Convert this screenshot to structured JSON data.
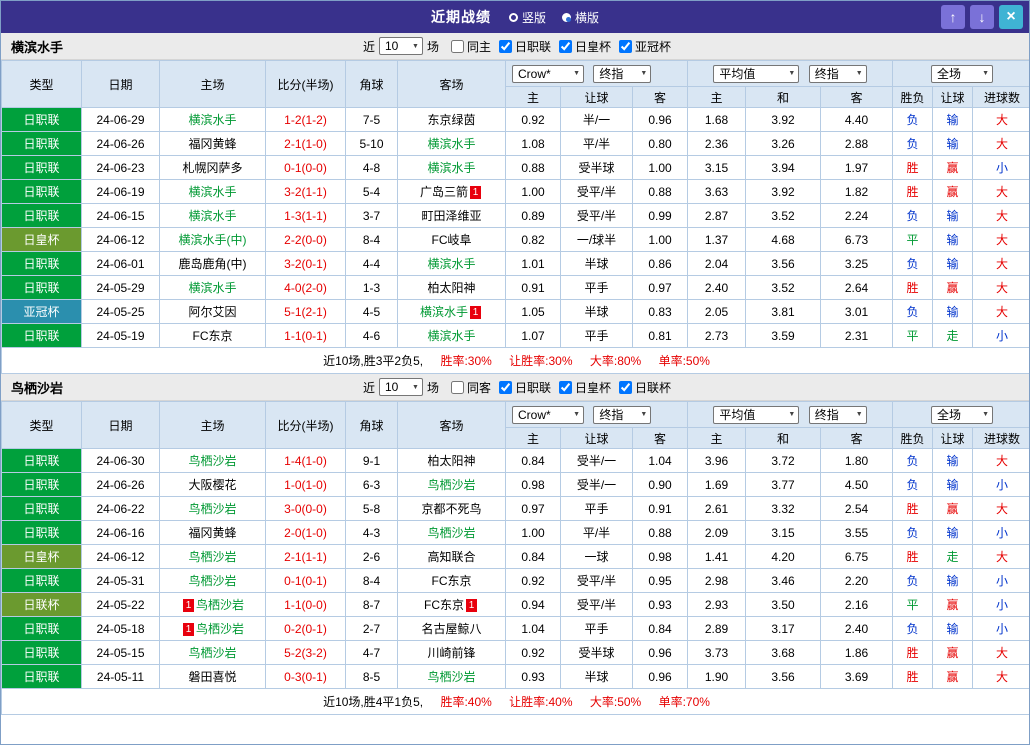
{
  "titlebar": {
    "title": "近期战绩",
    "views": [
      {
        "label": "竖版",
        "selected": false
      },
      {
        "label": "横版",
        "selected": true
      }
    ],
    "buttons": {
      "up": "↑",
      "down": "↓",
      "close": "×"
    }
  },
  "type_colors": {
    "日职联": "#00a03c",
    "日皇杯": "#6b9a2f",
    "亚冠杯": "#2b8fae",
    "日联杯": "#6b9a2f"
  },
  "result_colors": {
    "red": "#e60000",
    "blue": "#0033cc",
    "green": "#009933"
  },
  "sections": [
    {
      "team": "横滨水手",
      "filters": {
        "near": "近",
        "count": "10",
        "unit": "场",
        "checkboxes": [
          {
            "label": "同主",
            "checked": false
          },
          {
            "label": "日职联",
            "checked": true
          },
          {
            "label": "日皇杯",
            "checked": true
          },
          {
            "label": "亚冠杯",
            "checked": true
          }
        ]
      },
      "columns": {
        "type": "类型",
        "date": "日期",
        "home": "主场",
        "score": "比分(半场)",
        "corner": "角球",
        "away": "客场",
        "odds_source": "Crow*",
        "odds_final": "终指",
        "avg": "平均值",
        "avg_final": "终指",
        "scope": "全场",
        "sub": [
          "主",
          "让球",
          "客",
          "主",
          "和",
          "客",
          "胜负",
          "让球",
          "进球数"
        ]
      },
      "rows": [
        {
          "type": "日职联",
          "date": "24-06-29",
          "home": {
            "name": "横滨水手",
            "focus": true
          },
          "score": "1-2(1-2)",
          "corner": "7-5",
          "away": {
            "name": "东京绿茵"
          },
          "odds": [
            "0.92",
            "半/一",
            "0.96"
          ],
          "avg": [
            "1.68",
            "3.92",
            "4.40"
          ],
          "result": "负",
          "handicap_result": "输",
          "goals": "大"
        },
        {
          "type": "日职联",
          "date": "24-06-26",
          "home": {
            "name": "福冈黄蜂"
          },
          "score": "2-1(1-0)",
          "corner": "5-10",
          "away": {
            "name": "横滨水手",
            "focus": true
          },
          "odds": [
            "1.08",
            "平/半",
            "0.80"
          ],
          "avg": [
            "2.36",
            "3.26",
            "2.88"
          ],
          "result": "负",
          "handicap_result": "输",
          "goals": "大"
        },
        {
          "type": "日职联",
          "date": "24-06-23",
          "home": {
            "name": "札幌冈萨多"
          },
          "score": "0-1(0-0)",
          "corner": "4-8",
          "away": {
            "name": "横滨水手",
            "focus": true
          },
          "odds": [
            "0.88",
            "受半球",
            "1.00"
          ],
          "avg": [
            "3.15",
            "3.94",
            "1.97"
          ],
          "result": "胜",
          "handicap_result": "赢",
          "goals": "小"
        },
        {
          "type": "日职联",
          "date": "24-06-19",
          "home": {
            "name": "横滨水手",
            "focus": true
          },
          "score": "3-2(1-1)",
          "corner": "5-4",
          "away": {
            "name": "广岛三箭",
            "card": "1"
          },
          "odds": [
            "1.00",
            "受平/半",
            "0.88"
          ],
          "avg": [
            "3.63",
            "3.92",
            "1.82"
          ],
          "result": "胜",
          "handicap_result": "赢",
          "goals": "大"
        },
        {
          "type": "日职联",
          "date": "24-06-15",
          "home": {
            "name": "横滨水手",
            "focus": true
          },
          "score": "1-3(1-1)",
          "corner": "3-7",
          "away": {
            "name": "町田泽维亚"
          },
          "odds": [
            "0.89",
            "受平/半",
            "0.99"
          ],
          "avg": [
            "2.87",
            "3.52",
            "2.24"
          ],
          "result": "负",
          "handicap_result": "输",
          "goals": "大"
        },
        {
          "type": "日皇杯",
          "date": "24-06-12",
          "home": {
            "name": "横滨水手(中)",
            "focus": true
          },
          "score": "2-2(0-0)",
          "corner": "8-4",
          "away": {
            "name": "FC岐阜"
          },
          "odds": [
            "0.82",
            "一/球半",
            "1.00"
          ],
          "avg": [
            "1.37",
            "4.68",
            "6.73"
          ],
          "result": "平",
          "handicap_result": "输",
          "goals": "大"
        },
        {
          "type": "日职联",
          "date": "24-06-01",
          "home": {
            "name": "鹿岛鹿角(中)"
          },
          "score": "3-2(0-1)",
          "corner": "4-4",
          "away": {
            "name": "横滨水手",
            "focus": true
          },
          "odds": [
            "1.01",
            "半球",
            "0.86"
          ],
          "avg": [
            "2.04",
            "3.56",
            "3.25"
          ],
          "result": "负",
          "handicap_result": "输",
          "goals": "大"
        },
        {
          "type": "日职联",
          "date": "24-05-29",
          "home": {
            "name": "横滨水手",
            "focus": true
          },
          "score": "4-0(2-0)",
          "corner": "1-3",
          "away": {
            "name": "柏太阳神"
          },
          "odds": [
            "0.91",
            "平手",
            "0.97"
          ],
          "avg": [
            "2.40",
            "3.52",
            "2.64"
          ],
          "result": "胜",
          "handicap_result": "赢",
          "goals": "大"
        },
        {
          "type": "亚冠杯",
          "date": "24-05-25",
          "home": {
            "name": "阿尔艾因"
          },
          "score": "5-1(2-1)",
          "corner": "4-5",
          "away": {
            "name": "横滨水手",
            "focus": true,
            "card": "1"
          },
          "odds": [
            "1.05",
            "半球",
            "0.83"
          ],
          "avg": [
            "2.05",
            "3.81",
            "3.01"
          ],
          "result": "负",
          "handicap_result": "输",
          "goals": "大"
        },
        {
          "type": "日职联",
          "date": "24-05-19",
          "home": {
            "name": "FC东京"
          },
          "score": "1-1(0-1)",
          "corner": "4-6",
          "away": {
            "name": "横滨水手",
            "focus": true
          },
          "odds": [
            "1.07",
            "平手",
            "0.81"
          ],
          "avg": [
            "2.73",
            "3.59",
            "2.31"
          ],
          "result": "平",
          "handicap_result": "走",
          "goals": "小"
        }
      ],
      "summary": {
        "record": "近10场,胜3平2负5,",
        "stats": [
          "胜率:30%",
          "让胜率:30%",
          "大率:80%",
          "单率:50%"
        ]
      }
    },
    {
      "team": "鸟栖沙岩",
      "filters": {
        "near": "近",
        "count": "10",
        "unit": "场",
        "checkboxes": [
          {
            "label": "同客",
            "checked": false
          },
          {
            "label": "日职联",
            "checked": true
          },
          {
            "label": "日皇杯",
            "checked": true
          },
          {
            "label": "日联杯",
            "checked": true
          }
        ]
      },
      "columns": {
        "type": "类型",
        "date": "日期",
        "home": "主场",
        "score": "比分(半场)",
        "corner": "角球",
        "away": "客场",
        "odds_source": "Crow*",
        "odds_final": "终指",
        "avg": "平均值",
        "avg_final": "终指",
        "scope": "全场",
        "sub": [
          "主",
          "让球",
          "客",
          "主",
          "和",
          "客",
          "胜负",
          "让球",
          "进球数"
        ]
      },
      "rows": [
        {
          "type": "日职联",
          "date": "24-06-30",
          "home": {
            "name": "鸟栖沙岩",
            "focus": true
          },
          "score": "1-4(1-0)",
          "corner": "9-1",
          "away": {
            "name": "柏太阳神"
          },
          "odds": [
            "0.84",
            "受半/一",
            "1.04"
          ],
          "avg": [
            "3.96",
            "3.72",
            "1.80"
          ],
          "result": "负",
          "handicap_result": "输",
          "goals": "大"
        },
        {
          "type": "日职联",
          "date": "24-06-26",
          "home": {
            "name": "大阪樱花"
          },
          "score": "1-0(1-0)",
          "corner": "6-3",
          "away": {
            "name": "鸟栖沙岩",
            "focus": true
          },
          "odds": [
            "0.98",
            "受半/一",
            "0.90"
          ],
          "avg": [
            "1.69",
            "3.77",
            "4.50"
          ],
          "result": "负",
          "handicap_result": "输",
          "goals": "小"
        },
        {
          "type": "日职联",
          "date": "24-06-22",
          "home": {
            "name": "鸟栖沙岩",
            "focus": true
          },
          "score": "3-0(0-0)",
          "corner": "5-8",
          "away": {
            "name": "京都不死鸟"
          },
          "odds": [
            "0.97",
            "平手",
            "0.91"
          ],
          "avg": [
            "2.61",
            "3.32",
            "2.54"
          ],
          "result": "胜",
          "handicap_result": "赢",
          "goals": "大"
        },
        {
          "type": "日职联",
          "date": "24-06-16",
          "home": {
            "name": "福冈黄蜂"
          },
          "score": "2-0(1-0)",
          "corner": "4-3",
          "away": {
            "name": "鸟栖沙岩",
            "focus": true
          },
          "odds": [
            "1.00",
            "平/半",
            "0.88"
          ],
          "avg": [
            "2.09",
            "3.15",
            "3.55"
          ],
          "result": "负",
          "handicap_result": "输",
          "goals": "小"
        },
        {
          "type": "日皇杯",
          "date": "24-06-12",
          "home": {
            "name": "鸟栖沙岩",
            "focus": true
          },
          "score": "2-1(1-1)",
          "corner": "2-6",
          "away": {
            "name": "高知联合"
          },
          "odds": [
            "0.84",
            "一球",
            "0.98"
          ],
          "avg": [
            "1.41",
            "4.20",
            "6.75"
          ],
          "result": "胜",
          "handicap_result": "走",
          "goals": "大"
        },
        {
          "type": "日职联",
          "date": "24-05-31",
          "home": {
            "name": "鸟栖沙岩",
            "focus": true
          },
          "score": "0-1(0-1)",
          "corner": "8-4",
          "away": {
            "name": "FC东京"
          },
          "odds": [
            "0.92",
            "受平/半",
            "0.95"
          ],
          "avg": [
            "2.98",
            "3.46",
            "2.20"
          ],
          "result": "负",
          "handicap_result": "输",
          "goals": "小"
        },
        {
          "type": "日联杯",
          "date": "24-05-22",
          "home": {
            "name": "鸟栖沙岩",
            "focus": true,
            "card": "1"
          },
          "score": "1-1(0-0)",
          "corner": "8-7",
          "away": {
            "name": "FC东京",
            "card": "1"
          },
          "odds": [
            "0.94",
            "受平/半",
            "0.93"
          ],
          "avg": [
            "2.93",
            "3.50",
            "2.16"
          ],
          "result": "平",
          "handicap_result": "赢",
          "goals": "小"
        },
        {
          "type": "日职联",
          "date": "24-05-18",
          "home": {
            "name": "鸟栖沙岩",
            "focus": true,
            "card": "1"
          },
          "score": "0-2(0-1)",
          "corner": "2-7",
          "away": {
            "name": "名古屋鲸八"
          },
          "odds": [
            "1.04",
            "平手",
            "0.84"
          ],
          "avg": [
            "2.89",
            "3.17",
            "2.40"
          ],
          "result": "负",
          "handicap_result": "输",
          "goals": "小"
        },
        {
          "type": "日职联",
          "date": "24-05-15",
          "home": {
            "name": "鸟栖沙岩",
            "focus": true
          },
          "score": "5-2(3-2)",
          "corner": "4-7",
          "away": {
            "name": "川崎前锋"
          },
          "odds": [
            "0.92",
            "受半球",
            "0.96"
          ],
          "avg": [
            "3.73",
            "3.68",
            "1.86"
          ],
          "result": "胜",
          "handicap_result": "赢",
          "goals": "大"
        },
        {
          "type": "日职联",
          "date": "24-05-11",
          "home": {
            "name": "磐田喜悦"
          },
          "score": "0-3(0-1)",
          "corner": "8-5",
          "away": {
            "name": "鸟栖沙岩",
            "focus": true
          },
          "odds": [
            "0.93",
            "半球",
            "0.96"
          ],
          "avg": [
            "1.90",
            "3.56",
            "3.69"
          ],
          "result": "胜",
          "handicap_result": "赢",
          "goals": "大"
        }
      ],
      "summary": {
        "record": "近10场,胜4平1负5,",
        "stats": [
          "胜率:40%",
          "让胜率:40%",
          "大率:50%",
          "单率:70%"
        ]
      }
    }
  ]
}
